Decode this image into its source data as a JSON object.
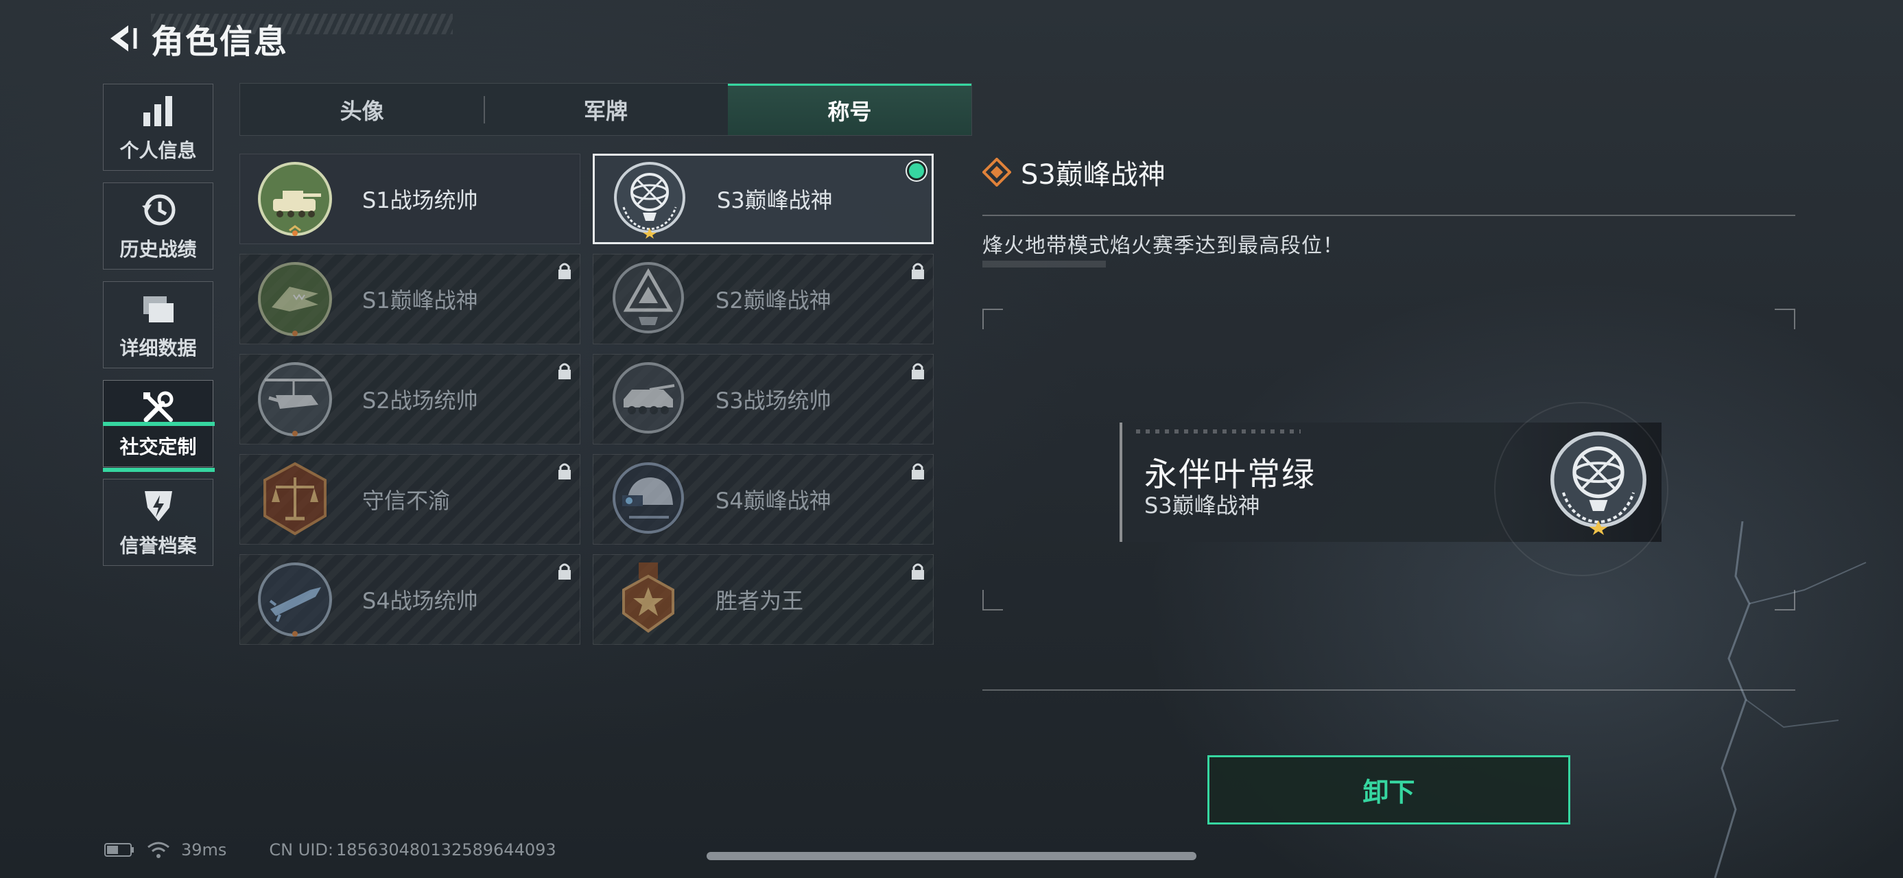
{
  "header": {
    "title": "角色信息",
    "back_icon": "back-arrow-icon"
  },
  "side_nav": {
    "items": [
      {
        "label": "个人信息",
        "icon": "bar-chart-icon",
        "active": false
      },
      {
        "label": "历史战绩",
        "icon": "history-icon",
        "active": false
      },
      {
        "label": "详细数据",
        "icon": "folder-icon",
        "active": false
      },
      {
        "label": "社交定制",
        "icon": "tools-icon",
        "active": true
      },
      {
        "label": "信誉档案",
        "icon": "credit-badge-icon",
        "active": false
      }
    ],
    "active_color": "#36d6a0"
  },
  "tabs": [
    {
      "label": "头像",
      "selected": false
    },
    {
      "label": "军牌",
      "selected": false
    },
    {
      "label": "称号",
      "selected": true
    }
  ],
  "titles": [
    {
      "label": "S1战场统帅",
      "emblem": "tank-emblem-icon",
      "locked": false,
      "selected": false
    },
    {
      "label": "S3巅峰战神",
      "emblem": "armillary-emblem-icon",
      "locked": false,
      "selected": true,
      "equipped": true
    },
    {
      "label": "S1巅峰战神",
      "emblem": "crocodile-emblem-icon",
      "locked": true,
      "selected": false
    },
    {
      "label": "S2巅峰战神",
      "emblem": "triangle-emblem-icon",
      "locked": true,
      "selected": false
    },
    {
      "label": "S2战场统帅",
      "emblem": "helicopter-emblem-icon",
      "locked": true,
      "selected": false
    },
    {
      "label": "S3战场统帅",
      "emblem": "armored-vehicle-emblem-icon",
      "locked": true,
      "selected": false
    },
    {
      "label": "守信不渝",
      "emblem": "scales-emblem-icon",
      "locked": true,
      "selected": false
    },
    {
      "label": "S4巅峰战神",
      "emblem": "helmet-emblem-icon",
      "locked": true,
      "selected": false
    },
    {
      "label": "S4战场统帅",
      "emblem": "missile-emblem-icon",
      "locked": true,
      "selected": false
    },
    {
      "label": "胜者为王",
      "emblem": "medal-emblem-icon",
      "locked": true,
      "selected": false
    }
  ],
  "detail": {
    "title": "S3巅峰战神",
    "title_icon": "diamond-rank-icon",
    "description": "烽火地带模式焰火赛季达到最高段位！",
    "preview": {
      "player_name": "永伴叶常绿",
      "title": "S3巅峰战神",
      "emblem": "armillary-emblem-icon"
    }
  },
  "action": {
    "label": "卸下"
  },
  "status_bar": {
    "battery_icon": "battery-icon",
    "wifi_icon": "wifi-icon",
    "ping": "39ms",
    "uid_label": "CN UID:",
    "uid": "185630480132589644093"
  },
  "colors": {
    "accent": "#36d6a0",
    "equipped_dot": "#36d6a0",
    "rank_orange": "#e0823a"
  }
}
